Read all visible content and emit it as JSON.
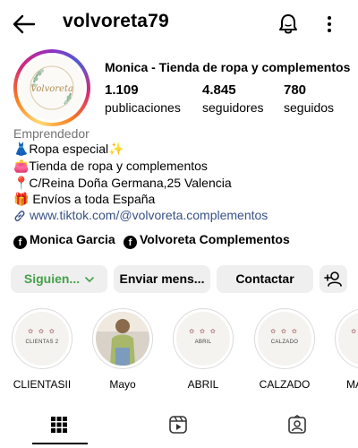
{
  "header": {
    "username": "volvoreta79"
  },
  "profile": {
    "avatar_text": "Volvoreta",
    "display_name": "Monica - Tienda de ropa y complementos",
    "stats": [
      {
        "value": "1.109",
        "label": "publicaciones"
      },
      {
        "value": "4.845",
        "label": "seguidores"
      },
      {
        "value": "780",
        "label": "seguidos"
      }
    ],
    "category": "Emprendedor",
    "bio": [
      "👗Ropa especial✨",
      "👛Tienda de ropa y complementos",
      "📍C/Reina Doña Germana,25 Valencia",
      "🎁 Envíos a toda España"
    ],
    "link": "www.tiktok.com/@volvoreta.complementos",
    "facebook_links": [
      "Monica Garcia",
      "Volvoreta Complementos"
    ]
  },
  "buttons": {
    "following": "Siguien...",
    "message": "Enviar mens...",
    "contact": "Contactar"
  },
  "highlights": [
    {
      "label": "CLIENTASII",
      "cover_text": "CLIENTAS 2"
    },
    {
      "label": "Mayo",
      "cover_text": ""
    },
    {
      "label": "ABRIL",
      "cover_text": "ABRIL"
    },
    {
      "label": "CALZADO",
      "cover_text": "CALZADO"
    },
    {
      "label": "MA",
      "cover_text": ""
    }
  ],
  "tabs": [
    "grid-icon",
    "reels-icon",
    "tagged-icon"
  ],
  "colors": {
    "following_green": "#45a049",
    "link_blue": "#385185",
    "button_bg": "#efefef"
  }
}
